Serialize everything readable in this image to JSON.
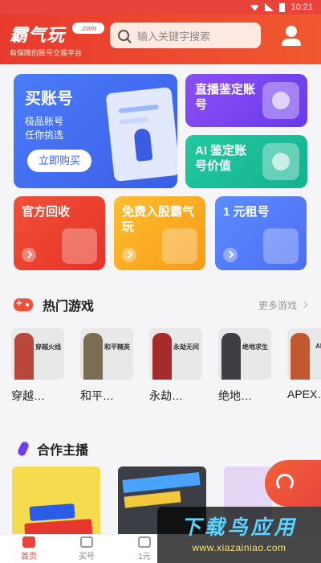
{
  "status_bar": {
    "time": "10:21"
  },
  "header": {
    "logo_text": "霸气玩",
    "logo_domain": ".com",
    "logo_slogan": "有保障的账号交易平台",
    "search_placeholder": "输入关键字搜索"
  },
  "cards": {
    "buy": {
      "title": "买账号",
      "subtitle_1": "极品账号",
      "subtitle_2": "任你挑选",
      "button": "立即购买"
    },
    "live": {
      "title": "直播鉴定账号"
    },
    "ai": {
      "title": "AI 鉴定账号价值"
    },
    "recycle": {
      "title": "官方回收"
    },
    "free": {
      "title": "免费入股霸气玩"
    },
    "rent": {
      "title": "1 元租号"
    }
  },
  "hot_games": {
    "title": "热门游戏",
    "more": "更多游戏",
    "items": [
      {
        "name": "穿越…",
        "caption": "穿越火线",
        "color": "#b8473a"
      },
      {
        "name": "和平…",
        "caption": "和平精英",
        "color": "#7a6d52"
      },
      {
        "name": "永劫…",
        "caption": "永劫无间",
        "color": "#a52a2a"
      },
      {
        "name": "绝地…",
        "caption": "绝地求生",
        "color": "#3e3e44"
      },
      {
        "name": "APEX…",
        "caption": "APEX",
        "color": "#c2582f"
      }
    ]
  },
  "streamers": {
    "title": "合作主播"
  },
  "tabbar": {
    "items": [
      "首页",
      "买号",
      "1元"
    ]
  },
  "watermark": {
    "text": "下载鸟应用",
    "url": "www.xiazainiao.com"
  },
  "colors": {
    "brand": "#e8443c",
    "blue": "#3a5ee8",
    "purple": "#6a3ae8",
    "green": "#14b28f"
  }
}
